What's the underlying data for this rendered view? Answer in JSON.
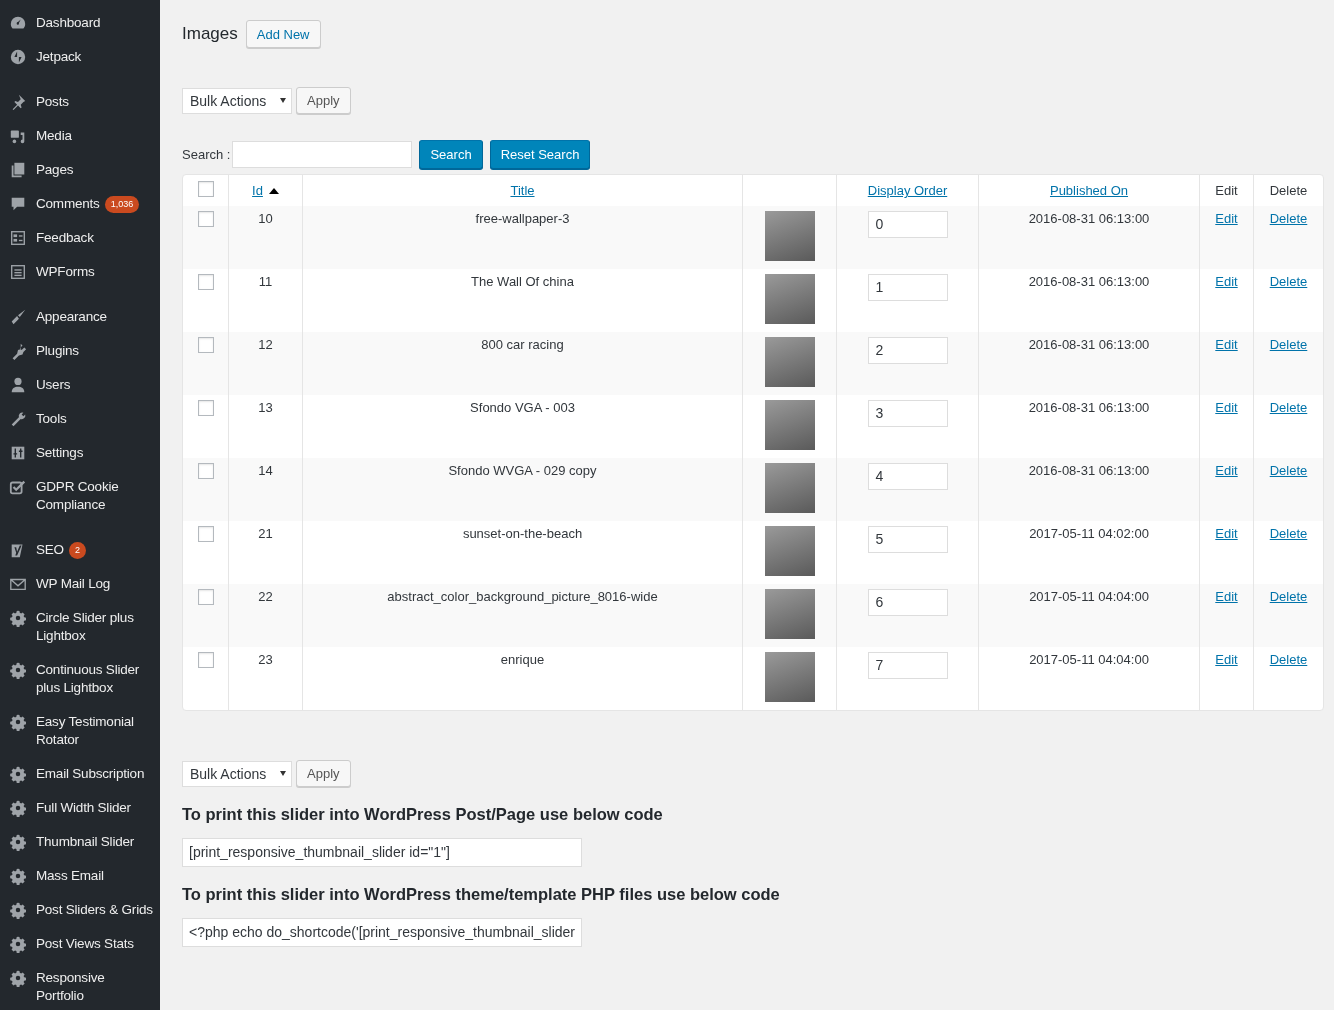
{
  "sidebar": {
    "groups": [
      [
        {
          "label": "Dashboard"
        },
        {
          "label": "Jetpack"
        }
      ],
      [
        {
          "label": "Posts"
        },
        {
          "label": "Media"
        },
        {
          "label": "Pages"
        },
        {
          "label": "Comments",
          "badge": "1,036"
        },
        {
          "label": "Feedback"
        },
        {
          "label": "WPForms"
        }
      ],
      [
        {
          "label": "Appearance"
        },
        {
          "label": "Plugins"
        },
        {
          "label": "Users"
        },
        {
          "label": "Tools"
        },
        {
          "label": "Settings"
        },
        {
          "label": "GDPR Cookie\nCompliance"
        }
      ],
      [
        {
          "label": "SEO",
          "badge": "2"
        },
        {
          "label": "WP Mail Log"
        },
        {
          "label": "Circle Slider plus\nLightbox"
        },
        {
          "label": "Continuous Slider\nplus Lightbox"
        },
        {
          "label": "Easy Testimonial\nRotator"
        },
        {
          "label": "Email Subscription"
        },
        {
          "label": "Full Width Slider"
        },
        {
          "label": "Thumbnail Slider"
        },
        {
          "label": "Mass Email"
        },
        {
          "label": "Post Sliders & Grids"
        },
        {
          "label": "Post Views Stats"
        },
        {
          "label": "Responsive\nPortfolio"
        }
      ]
    ]
  },
  "page": {
    "title": "Images",
    "add_new": "Add New"
  },
  "bulk_top": {
    "select": "Bulk Actions",
    "apply": "Apply"
  },
  "search": {
    "label": "Search :",
    "button": "Search",
    "reset": "Reset Search"
  },
  "table": {
    "select_all_checked": false,
    "columns": [
      {
        "kind": "check"
      },
      {
        "kind": "sort",
        "label": "Id",
        "sorted_ascending": true
      },
      {
        "kind": "sort",
        "label": "Title"
      },
      {
        "kind": "blank"
      },
      {
        "kind": "sort",
        "label": "Display Order"
      },
      {
        "kind": "sort",
        "label": "Published On"
      },
      {
        "kind": "plain",
        "label": "Edit"
      },
      {
        "kind": "plain",
        "label": "Delete"
      }
    ],
    "rows": [
      {
        "checked": false,
        "id": "10",
        "title": "free-wallpaper-3",
        "order": "0",
        "published": "2016-08-31 06:13:00",
        "edit": "Edit",
        "delete": "Delete"
      },
      {
        "checked": false,
        "id": "11",
        "title": "The Wall Of china",
        "order": "1",
        "published": "2016-08-31 06:13:00",
        "edit": "Edit",
        "delete": "Delete"
      },
      {
        "checked": false,
        "id": "12",
        "title": "800 car racing",
        "order": "2",
        "published": "2016-08-31 06:13:00",
        "edit": "Edit",
        "delete": "Delete"
      },
      {
        "checked": false,
        "id": "13",
        "title": "Sfondo VGA - 003",
        "order": "3",
        "published": "2016-08-31 06:13:00",
        "edit": "Edit",
        "delete": "Delete"
      },
      {
        "checked": false,
        "id": "14",
        "title": "Sfondo WVGA - 029 copy",
        "order": "4",
        "published": "2016-08-31 06:13:00",
        "edit": "Edit",
        "delete": "Delete"
      },
      {
        "checked": false,
        "id": "21",
        "title": "sunset-on-the-beach",
        "order": "5",
        "published": "2017-05-11 04:02:00",
        "edit": "Edit",
        "delete": "Delete"
      },
      {
        "checked": false,
        "id": "22",
        "title": "abstract_color_background_picture_8016-wide",
        "order": "6",
        "published": "2017-05-11 04:04:00",
        "edit": "Edit",
        "delete": "Delete"
      },
      {
        "checked": false,
        "id": "23",
        "title": "enrique",
        "order": "7",
        "published": "2017-05-11 04:04:00",
        "edit": "Edit",
        "delete": "Delete"
      }
    ]
  },
  "bulk_bottom": {
    "select": "Bulk Actions",
    "apply": "Apply"
  },
  "shortcodes": [
    {
      "heading": "To print this slider into WordPress Post/Page use below code",
      "code": "[print_responsive_thumbnail_slider id=\"1\"]"
    },
    {
      "heading": "To print this slider into WordPress theme/template PHP files use below code",
      "code": "<?php echo do_shortcode('[print_responsive_thumbnail_slider"
    }
  ]
}
